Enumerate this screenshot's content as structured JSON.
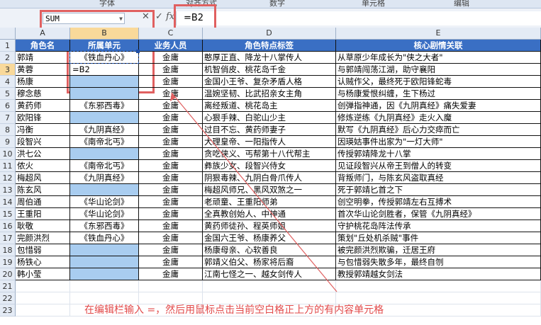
{
  "ribbon": [
    "字体",
    "对齐方式",
    "数字",
    "单元格",
    "编辑"
  ],
  "formula_bar": {
    "name_box": "SUM",
    "cancel_icon": "✕",
    "enter_icon": "✓",
    "fx_label": "fx",
    "formula": "=B2"
  },
  "columns": [
    "A",
    "B",
    "C",
    "D",
    "E"
  ],
  "selected_column": "B",
  "selected_row": 3,
  "headers": [
    "角色名",
    "所属单元",
    "业务人员",
    "角色特点标签",
    "核心剧情关联"
  ],
  "rows": [
    [
      "郭靖",
      "《铁血丹心》",
      "金庸",
      "憨厚正直、降龙十八掌传人",
      "从草原少年成长为\"侠之大者\""
    ],
    [
      "黄蓉",
      "=B2",
      "金庸",
      "机智俏皮、桃花岛千金",
      "与郭靖闯荡江湖，助守襄阳"
    ],
    [
      "杨康",
      "",
      "金庸",
      "金国小王爷、复杂矛盾人格",
      "认贼作父，最终死于欧阳锋蛇毒"
    ],
    [
      "穆念慈",
      "",
      "金庸",
      "温婉坚韧、比武招亲女主角",
      "与杨康爱恨纠缠，生下杨过"
    ],
    [
      "黄药师",
      "《东邪西毒》",
      "金庸",
      "离经叛道、桃花岛主",
      "创弹指神通，因《九阴真经》痛失爱妻"
    ],
    [
      "欧阳锋",
      "",
      "金庸",
      "心狠手辣、白驼山少主",
      "修炼逆练《九阴真经》走火入魔"
    ],
    [
      "冯衡",
      "《九阴真经》",
      "金庸",
      "过目不忘、黄药师妻子",
      "默写《九阴真经》后心力交瘁而亡"
    ],
    [
      "段智兴",
      "《南帝北丐》",
      "金庸",
      "大理皇帝、一阳指传人",
      "因瑛姑事件出家为\"一灯大师\""
    ],
    [
      "洪七公",
      "",
      "金庸",
      "贪吃侠义、丐帮第十八代帮主",
      "传授郭靖降龙十八掌"
    ],
    [
      "侬火",
      "《南帝北丐》",
      "金庸",
      "彝族少女、段智兴侍女",
      "见证段智兴从帝王到僧人的转变"
    ],
    [
      "梅超风",
      "《九阴真经》",
      "金庸",
      "阴狠毒辣、九阴白骨爪传人",
      "背叛师门，与陈玄风盗取真经"
    ],
    [
      "陈玄风",
      "",
      "金庸",
      "梅超风师兄、黑风双煞之一",
      "死于郭靖匕首之下"
    ],
    [
      "周伯通",
      "《华山论剑》",
      "金庸",
      "老顽童、王重阳师弟",
      "创空明拳，传授郭靖左右互搏术"
    ],
    [
      "王重阳",
      "《华山论剑》",
      "金庸",
      "全真教创始人、中神通",
      "首次华山论剑胜者，保管《九阴真经》"
    ],
    [
      "耿敬",
      "《东邪西毒》",
      "金庸",
      "黄药师徒孙、程英师姐",
      "守护桃花岛阵法传承"
    ],
    [
      "完颜洪烈",
      "《铁血丹心》",
      "金庸",
      "金国六王爷、杨康养父",
      "策划\"丘处机杀贼\"事件"
    ],
    [
      "包惜弱",
      "",
      "金庸",
      "杨康母亲、心软善良",
      "被完颜洪烈欺骗，迁居王府"
    ],
    [
      "杨铁心",
      "",
      "金庸",
      "郭靖义伯父、杨家将后裔",
      "与包惜弱失散多年，最终自刎"
    ],
    [
      "韩小莹",
      "",
      "金庸",
      "江南七怪之一、越女剑传人",
      "教授郭靖越女剑法"
    ]
  ],
  "blank_row_numbers": [
    21,
    22,
    23
  ],
  "annotation": "在编辑栏输入 =，然后用鼠标点击当前空白格正上方的有内容单元格",
  "colors": {
    "header": "#3a6fc4",
    "blank_cell": "#a9cdf0",
    "highlight": "#e06060",
    "annotation": "#e24a4a"
  }
}
